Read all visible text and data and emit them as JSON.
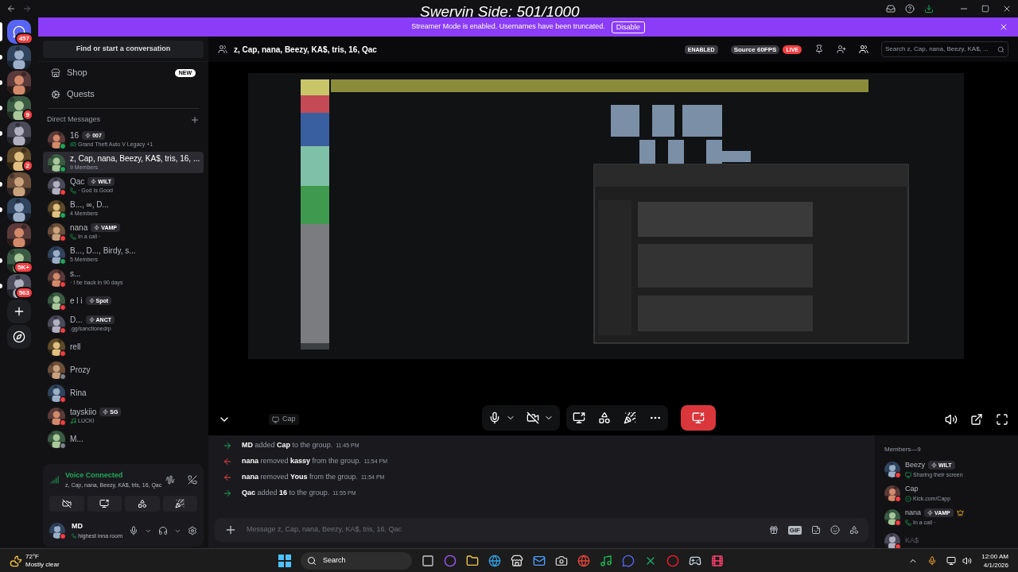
{
  "overlay_caption": "Swervin Side: 501/1000",
  "banner": {
    "text": "Streamer Mode is enabled. Usernames have been truncated.",
    "button": "Disable"
  },
  "servers": [
    {
      "kind": "home",
      "badge": "457",
      "selected": true,
      "unread": false
    },
    {
      "kind": "server",
      "selected": false,
      "unread": true
    },
    {
      "kind": "server",
      "selected": false,
      "unread": true
    },
    {
      "kind": "server",
      "badge": "9",
      "selected": false,
      "unread": true
    },
    {
      "kind": "server",
      "selected": false,
      "unread": true
    },
    {
      "kind": "server",
      "badge": "2",
      "selected": false,
      "unread": true
    },
    {
      "kind": "server",
      "selected": false,
      "unread": true
    },
    {
      "kind": "server",
      "selected": false,
      "unread": true
    },
    {
      "kind": "server",
      "selected": false,
      "unread": false
    },
    {
      "kind": "server",
      "badge": "5K+",
      "selected": false,
      "unread": true
    },
    {
      "kind": "server",
      "badge": "563",
      "selected": false,
      "unread": true
    },
    {
      "kind": "add",
      "selected": false,
      "unread": false
    },
    {
      "kind": "discover",
      "selected": false,
      "unread": false
    }
  ],
  "sidebar": {
    "search": "Find or start a conversation",
    "nav": [
      {
        "kind": "shop",
        "label": "Shop",
        "badge": "NEW"
      },
      {
        "kind": "quests",
        "label": "Quests"
      }
    ],
    "section": "Direct Messages",
    "dms": [
      {
        "name": "16",
        "tag": "007",
        "kind": "game",
        "sub": "Grand Theft Auto V Legacy +1",
        "color": "#23a55a",
        "selected": false
      },
      {
        "name": "z, Cap, nana, Beezy, KA$, tris, 16, ...",
        "kind": "members",
        "sub": "9 Members",
        "color": "#23a55a",
        "selected": true
      },
      {
        "name": "Qac",
        "tag": "WILT",
        "kind": "phone",
        "sub": "· God Is Good",
        "color": "#f23f43",
        "selected": false
      },
      {
        "name": "B..., ∞, D...",
        "kind": "members",
        "sub": "4 Members",
        "color": "#23a55a",
        "selected": false
      },
      {
        "name": "nana",
        "tag": "VAMP",
        "kind": "phone",
        "sub": "In a call ·",
        "color": "#f23f43",
        "selected": false
      },
      {
        "name": "B..., D..., Birdy, s...",
        "kind": "members",
        "sub": "5 Members",
        "color": "#23a55a",
        "selected": false
      },
      {
        "name": "s...",
        "kind": "custom",
        "sub": "· I be back in 90 days",
        "color": "#f23f43",
        "selected": false
      },
      {
        "name": "e l i",
        "tag": "Spot",
        "color": "#f23f43",
        "selected": false
      },
      {
        "name": "D...",
        "tag": "ANCT",
        "kind": "custom",
        "sub": ".gg/sanctionedrp",
        "color": "#f23f43",
        "selected": false
      },
      {
        "name": "rell",
        "color": "#f23f43",
        "selected": false
      },
      {
        "name": "Prozy",
        "color": "#80848e",
        "selected": false
      },
      {
        "name": "Rina",
        "color": "#f23f43",
        "selected": false
      },
      {
        "name": "tayskiio",
        "tag": "SG",
        "kind": "music",
        "sub": "LUCKI",
        "color": "#f23f43",
        "selected": false
      },
      {
        "name": "M...",
        "color": "#80848e",
        "selected": false
      }
    ],
    "voice": {
      "title": "Voice Connected",
      "channel": "z, Cap, nana, Beezy, KA$, tris, 16, Qac"
    },
    "user": {
      "name": "MD",
      "status": "highest inna room",
      "color": "#f23f43"
    }
  },
  "header": {
    "title": "z, Cap, nana, Beezy, KA$, tris, 16, Qac",
    "enabled": "ENABLED",
    "source": "Source 60FPS",
    "live": "LIVE",
    "search_placeholder": "Search z, Cap, nana, Beezy, KA$, ..."
  },
  "stream": {
    "label": "Cap"
  },
  "messages": [
    {
      "kind": "join",
      "actor": "MD",
      "action": "added",
      "target": "Cap",
      "tail": "to the group.",
      "time": "11:45 PM"
    },
    {
      "kind": "leave",
      "actor": "nana",
      "action": "removed",
      "target": "kassy",
      "tail": "from the group.",
      "time": "11:54 PM"
    },
    {
      "kind": "leave",
      "actor": "nana",
      "action": "removed",
      "target": "Yous",
      "tail": "from the group.",
      "time": "11:54 PM"
    },
    {
      "kind": "join",
      "actor": "Qac",
      "action": "added",
      "target": "16",
      "tail": "to the group.",
      "time": "11:55 PM"
    }
  ],
  "composer": {
    "placeholder": "Message z, Cap, nana, Beezy, KA$, tris, 16, Qac",
    "gif": "GIF"
  },
  "members": {
    "title": "Members—9",
    "list": [
      {
        "name": "Beezy",
        "tag": "WILT",
        "kind": "screen",
        "sub": "Sharing their screen",
        "color": "#f23f43",
        "owner": false,
        "faded": false
      },
      {
        "name": "Cap",
        "kind": "verified",
        "sub": "Kick.com/Capp",
        "color": "#f23f43",
        "owner": false,
        "faded": false
      },
      {
        "name": "nana",
        "tag": "VAMP",
        "kind": "phone",
        "sub": "In a call ·",
        "color": "#f23f43",
        "owner": true,
        "faded": false
      },
      {
        "name": "KA$",
        "color": "#f23f43",
        "owner": false,
        "faded": true
      }
    ]
  },
  "taskbar": {
    "temp": "72°F",
    "weather": "Mostly clear",
    "search": "Search",
    "time": "12:00 AM",
    "date": "4/1/2026"
  }
}
